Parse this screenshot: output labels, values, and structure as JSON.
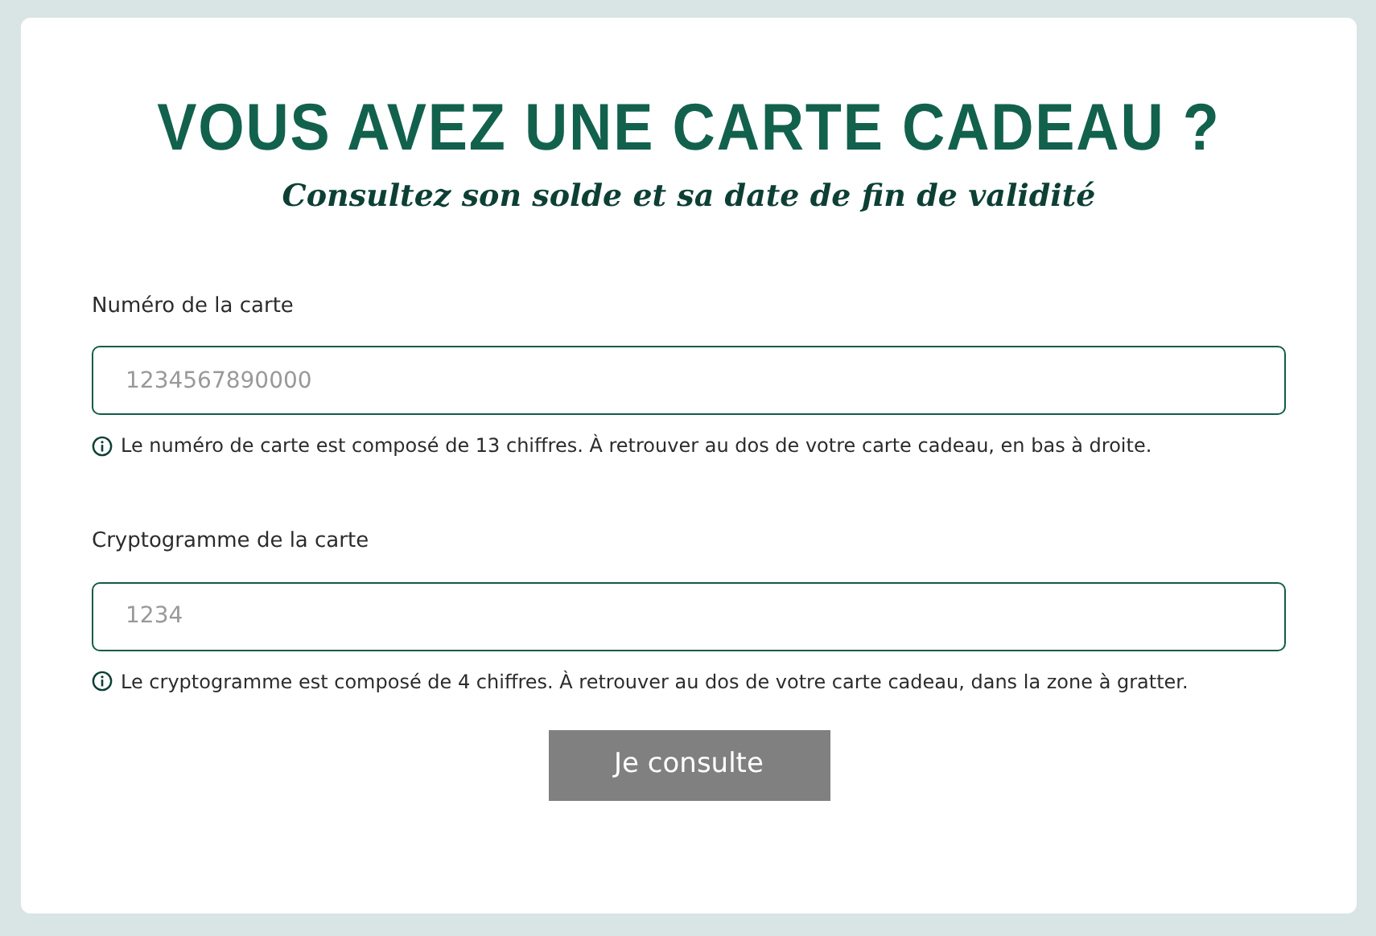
{
  "title": "VOUS AVEZ UNE CARTE CADEAU ?",
  "subtitle": "Consultez son solde et sa date de fin de validité",
  "fields": [
    {
      "label": "Numéro de la carte",
      "placeholder": "1234567890000",
      "hint": "Le numéro de carte est composé de 13 chiffres. À retrouver au dos de votre carte cadeau, en bas à droite."
    },
    {
      "label": "Cryptogramme de la carte",
      "placeholder": "1234",
      "hint": "Le cryptogramme est composé de 4 chiffres. À retrouver au dos de votre carte cadeau, dans la zone à gratter."
    }
  ],
  "submit": {
    "label": "Je consulte",
    "disabled": true
  }
}
